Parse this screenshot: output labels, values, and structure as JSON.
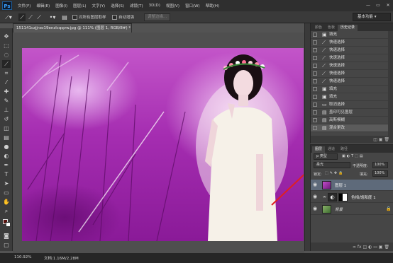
{
  "app": {
    "logo_text": "Ps",
    "menu": [
      "文件(F)",
      "编辑(E)",
      "图像(I)",
      "图层(L)",
      "文字(Y)",
      "选择(S)",
      "滤镜(T)",
      "3D(D)",
      "视图(V)",
      "窗口(W)",
      "帮助(H)"
    ],
    "window_controls": {
      "minimize": "—",
      "restore": "▭",
      "close": "✕"
    }
  },
  "options_bar": {
    "sample_all_layers": "对所有图层取样",
    "auto_enhance": "自动增强",
    "refine_edge": "调整边缘...",
    "workspace": "基本功能"
  },
  "document": {
    "tab_title": "151141czjjrxo19enzlcqqvw.jpg @ 111% (图层 1, RGB/8#) *",
    "zoom": "110.92%",
    "doc_info": "文档:1.16M/2.28M"
  },
  "history": {
    "tabs": [
      "颜色",
      "色板",
      "历史记录"
    ],
    "active_tab": "历史记录",
    "items": [
      "填充",
      "快速选择",
      "快速选择",
      "快速选择",
      "快速选择",
      "快速选择",
      "快速选择",
      "填充",
      "填充",
      "取消选择",
      "盖印可见图层",
      "高斯模糊",
      "混合更改"
    ],
    "selected_index": 12
  },
  "layers": {
    "tabs": [
      "图层",
      "通道",
      "路径"
    ],
    "kind_filter": "p 类型",
    "blend_mode": "柔光",
    "opacity_label": "不透明度:",
    "opacity": "100%",
    "lock_label": "锁定:",
    "fill_label": "填充:",
    "fill": "100%",
    "list": [
      {
        "name": "图层 1",
        "selected": true
      },
      {
        "name": "色相/饱和度 1",
        "selected": false
      },
      {
        "name": "背景",
        "selected": false
      }
    ]
  }
}
